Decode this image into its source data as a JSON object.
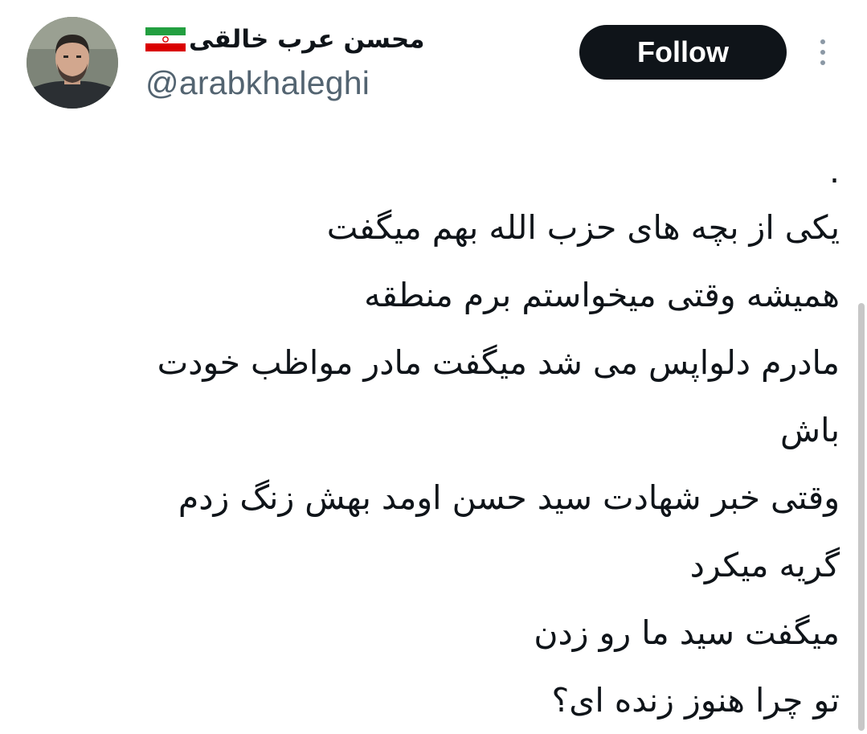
{
  "author": {
    "display_name": "محسن عرب خالقی",
    "handle": "@arabkhaleghi",
    "flag_icon": "iran-flag-icon"
  },
  "actions": {
    "follow_label": "Follow",
    "more_icon": "vertical-ellipsis-icon"
  },
  "tweet": {
    "lines": [
      ".",
      "یکی از بچه های حزب الله بهم میگفت",
      "همیشه وقتی میخواستم برم منطقه",
      "مادرم دلواپس می شد میگفت مادر مواظب خودت",
      "باش",
      "وقتی خبر شهادت سید حسن اومد بهش زنگ زدم",
      "گریه میکرد",
      "میگفت سید ما رو زدن",
      "تو چرا هنوز زنده ای؟"
    ]
  },
  "colors": {
    "text": "#0f1419",
    "muted": "#536471",
    "follow_bg": "#0f1419",
    "follow_text": "#ffffff"
  }
}
